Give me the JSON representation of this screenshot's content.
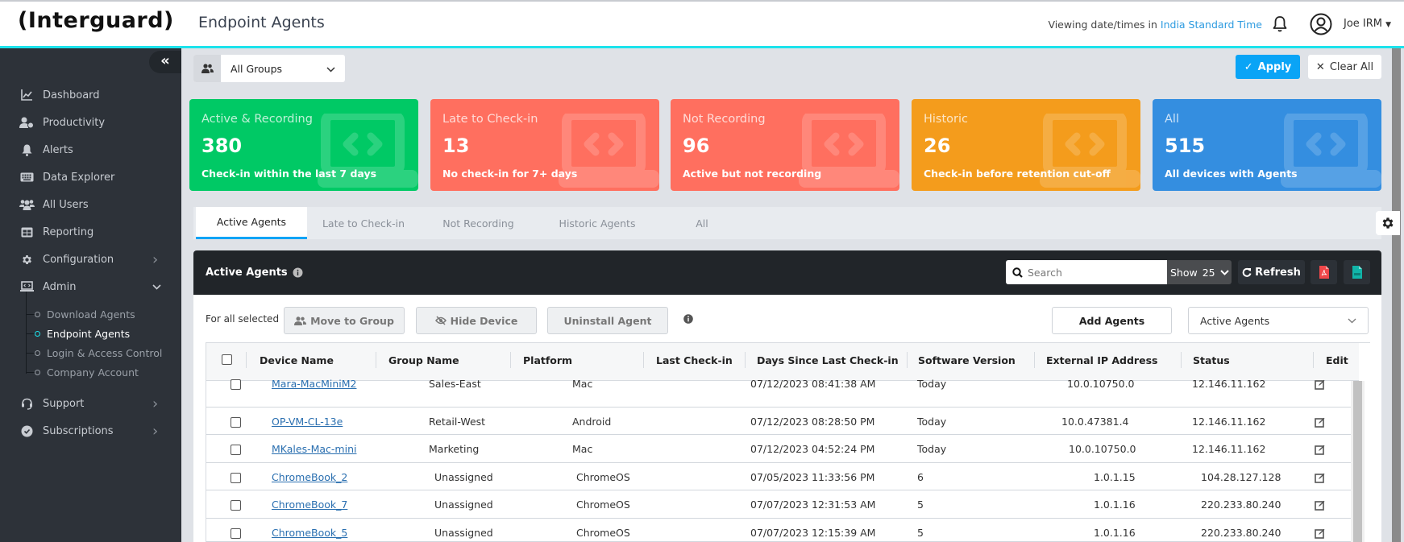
{
  "header": {
    "logo": "(Interguard)",
    "title": "Endpoint Agents",
    "timezone_prefix": "Viewing date/times in ",
    "timezone_link": "India Standard Time",
    "user_name": "Joe IRM"
  },
  "sidebar": {
    "items": [
      {
        "label": "Dashboard",
        "icon": "chart-line-icon"
      },
      {
        "label": "Productivity",
        "icon": "user-clock-icon"
      },
      {
        "label": "Alerts",
        "icon": "bell-icon"
      },
      {
        "label": "Data Explorer",
        "icon": "keyboard-icon"
      },
      {
        "label": "All Users",
        "icon": "users-icon"
      },
      {
        "label": "Reporting",
        "icon": "table-icon"
      },
      {
        "label": "Configuration",
        "icon": "gear-icon",
        "chevron": "›"
      },
      {
        "label": "Admin",
        "icon": "laptop-code-icon",
        "chevron": "⌄"
      }
    ],
    "admin_sub": [
      {
        "label": "Download Agents",
        "active": false
      },
      {
        "label": "Endpoint Agents",
        "active": true
      },
      {
        "label": "Login & Access Control",
        "active": false
      },
      {
        "label": "Company Account",
        "active": false
      }
    ],
    "bottom_items": [
      {
        "label": "Support",
        "icon": "headset-icon",
        "chevron": "›"
      },
      {
        "label": "Subscriptions",
        "icon": "check-circle-icon",
        "chevron": "›"
      }
    ]
  },
  "filters": {
    "group_value": "All Groups",
    "apply_label": "Apply",
    "clear_label": "Clear All"
  },
  "cards": [
    {
      "title": "Active & Recording",
      "value": "380",
      "desc": "Check-in within the last 7 days",
      "color": "#00c965"
    },
    {
      "title": "Late to Check-in",
      "value": "13",
      "desc": "No check-in for 7+ days",
      "color": "#ff6f5f"
    },
    {
      "title": "Not Recording",
      "value": "96",
      "desc": "Active but not recording",
      "color": "#ff6f5f"
    },
    {
      "title": "Historic",
      "value": "26",
      "desc": "Check-in before retention cut-off",
      "color": "#f49c1c"
    },
    {
      "title": "All",
      "value": "515",
      "desc": "All devices with Agents",
      "color": "#348ee0"
    }
  ],
  "tabs": [
    {
      "label": "Active Agents",
      "active": true
    },
    {
      "label": "Late to Check-in",
      "active": false
    },
    {
      "label": "Not Recording",
      "active": false
    },
    {
      "label": "Historic Agents",
      "active": false
    },
    {
      "label": "All",
      "active": false
    }
  ],
  "panel": {
    "title": "Active Agents",
    "search_placeholder": "Search",
    "show_label": "Show",
    "show_value": "25",
    "refresh_label": "Refresh",
    "for_all_selected": "For all selected",
    "move_to_group": "Move to Group",
    "hide_device": "Hide Device",
    "uninstall_agent": "Uninstall Agent",
    "add_agents": "Add Agents",
    "agents_filter_value": "Active Agents"
  },
  "table": {
    "columns": [
      "Device Name",
      "Group Name",
      "Platform",
      "Last Check-in",
      "Days Since Last Check-in",
      "Software Version",
      "External IP Address",
      "Status",
      "Edit"
    ],
    "rows": [
      {
        "device": "Mara-MacMiniM2",
        "group": "Sales-East",
        "platform": "Mac",
        "last_checkin": "07/12/2023 08:41:38 AM",
        "days": "Today",
        "version": "10.0.10750.0",
        "ip": "12.146.11.162"
      },
      {
        "device": "OP-VM-CL-13e",
        "group": "Retail-West",
        "platform": "Android",
        "last_checkin": "07/12/2023 08:28:50 PM",
        "days": "Today",
        "version": "10.0.47381.4",
        "ip": "12.146.11.162"
      },
      {
        "device": "MKales-Mac-mini",
        "group": "Marketing",
        "platform": "Mac",
        "last_checkin": "07/12/2023 04:52:24 PM",
        "days": "Today",
        "version": "10.0.10750.0",
        "ip": "12.146.11.162"
      },
      {
        "device": "ChromeBook_2",
        "group": "Unassigned",
        "platform": "ChromeOS",
        "last_checkin": "07/05/2023 11:33:56 PM",
        "days": "6",
        "version": "1.0.1.15",
        "ip": "104.28.127.128"
      },
      {
        "device": "ChromeBook_7",
        "group": "Unassigned",
        "platform": "ChromeOS",
        "last_checkin": "07/07/2023 12:31:53 AM",
        "days": "5",
        "version": "1.0.1.16",
        "ip": "220.233.80.240"
      },
      {
        "device": "ChromeBook_5",
        "group": "Unassigned",
        "platform": "ChromeOS",
        "last_checkin": "07/07/2023 12:15:39 AM",
        "days": "5",
        "version": "1.0.1.16",
        "ip": "220.233.80.240"
      }
    ]
  }
}
